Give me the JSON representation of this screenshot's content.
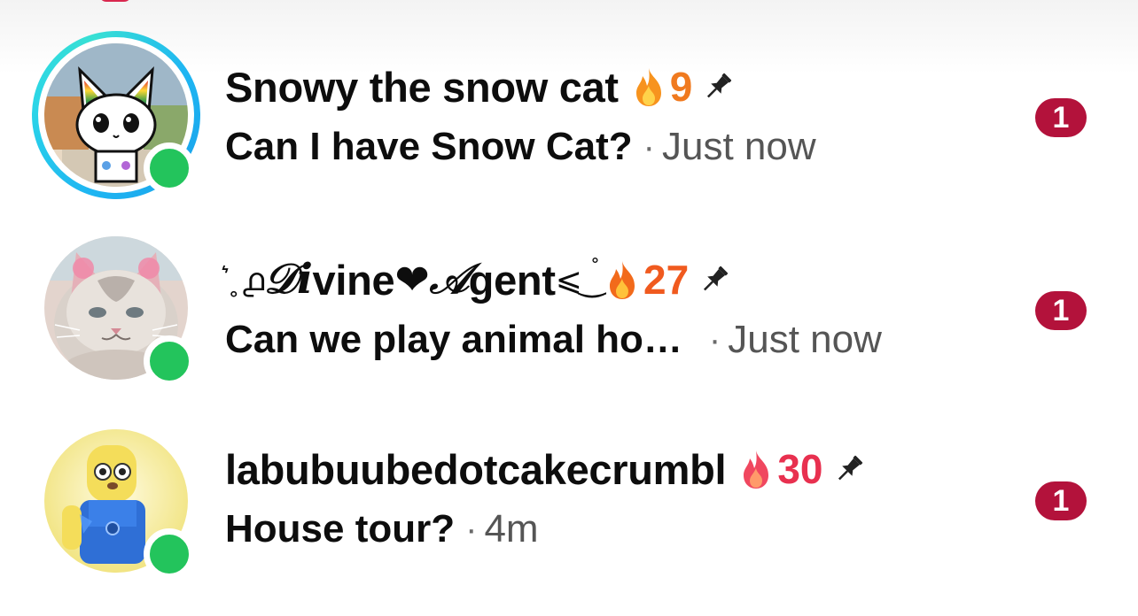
{
  "chats": [
    {
      "name": "Snowy the snow cat",
      "streak_count": "9",
      "streak_color": "#f07a1f",
      "message": "Can I have Snow Cat?",
      "separator": "·",
      "time": "Just now",
      "unread_count": "1",
      "has_story_ring": true,
      "online": true,
      "pinned": true
    },
    {
      "name_parts": [
        "͛ ̥ ൧ ",
        "𝒟i",
        "vine ",
        "❤ ",
        "𝒜",
        "gent",
        "⩽ ͜ ",
        "˚"
      ],
      "name": ".𖥔 𝒟ivine ❤ 𝒜gent⩽ ͜ ˚",
      "streak_count": "27",
      "streak_color": "#f05a1f",
      "message": "Can we play animal ho…",
      "separator": "·",
      "time": "Just now",
      "unread_count": "1",
      "has_story_ring": false,
      "online": true,
      "pinned": true
    },
    {
      "name": "labubuubedotcakecrumbl",
      "streak_count": "30",
      "streak_color": "#e8304f",
      "message": "House tour?",
      "separator": "·",
      "time": "4m",
      "unread_count": "1",
      "has_story_ring": false,
      "online": true,
      "pinned": true
    }
  ],
  "colors": {
    "online": "#23c45c",
    "badge": "#b3123b",
    "story_ring": "#1fb6f2"
  },
  "icons": {
    "streak": "fire-icon",
    "pin": "pin-icon"
  }
}
